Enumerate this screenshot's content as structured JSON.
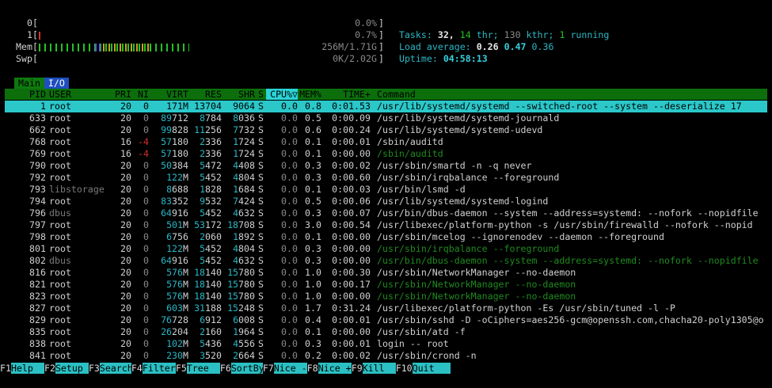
{
  "meters": {
    "cpu0": {
      "label": "0",
      "bracket_open": "[",
      "bracket_close": "]",
      "value": "0.0%",
      "fill": 0.0
    },
    "cpu1": {
      "label": "1",
      "bracket_open": "[",
      "bracket_close": "]",
      "value": "0.7%",
      "fill": 0.007
    },
    "mem": {
      "label": "Mem",
      "bracket_open": "[",
      "bracket_close": "]",
      "value": "256M/1.71G",
      "fill": 0.146
    },
    "swp": {
      "label": "Swp",
      "bracket_open": "[",
      "bracket_close": "]",
      "value": "0K/2.02G",
      "fill": 0.0
    }
  },
  "summary": {
    "tasks_label": "Tasks:",
    "tasks": "32,",
    "threads": "14",
    "thr_label": "thr;",
    "kthreads": "130",
    "kthr_label": "kthr;",
    "running": "1",
    "running_label": "running",
    "load_label": "Load average:",
    "load1": "0.26",
    "load5": "0.47",
    "load15": "0.36",
    "uptime_label": "Uptime:",
    "uptime": "04:58:13"
  },
  "tabs": [
    {
      "label": "Main"
    },
    {
      "label": "I/O"
    }
  ],
  "columns": [
    "PID",
    "USER",
    "PRI",
    "NI",
    "VIRT",
    "RES",
    "SHR",
    "S",
    "CPU%▽",
    "MEM%",
    "TIME+",
    "Command"
  ],
  "processes": [
    {
      "pid": "1",
      "user": "root",
      "pri": "20",
      "ni": "0",
      "virt": "171M",
      "res": "13704",
      "shr": "9064",
      "s": "S",
      "cpu": "0.0",
      "mem": "0.8",
      "time": "0:01.53",
      "cmd": "/usr/lib/systemd/systemd --switched-root --system --deserialize 17",
      "selected": true
    },
    {
      "pid": "633",
      "user": "root",
      "pri": "20",
      "ni": "0",
      "virt": "89712",
      "res": "8784",
      "shr": "8036",
      "s": "S",
      "cpu": "0.0",
      "mem": "0.5",
      "time": "0:00.09",
      "cmd": "/usr/lib/systemd/systemd-journald"
    },
    {
      "pid": "662",
      "user": "root",
      "pri": "20",
      "ni": "0",
      "virt": "99828",
      "res": "11256",
      "shr": "7732",
      "s": "S",
      "cpu": "0.0",
      "mem": "0.6",
      "time": "0:00.24",
      "cmd": "/usr/lib/systemd/systemd-udevd"
    },
    {
      "pid": "768",
      "user": "root",
      "pri": "16",
      "ni": "-4",
      "virt": "57180",
      "res": "2336",
      "shr": "1724",
      "s": "S",
      "cpu": "0.0",
      "mem": "0.1",
      "time": "0:00.01",
      "cmd": "/sbin/auditd"
    },
    {
      "pid": "769",
      "user": "root",
      "pri": "16",
      "ni": "-4",
      "virt": "57180",
      "res": "2336",
      "shr": "1724",
      "s": "S",
      "cpu": "0.0",
      "mem": "0.1",
      "time": "0:00.00",
      "cmd": "/sbin/auditd",
      "thread": true
    },
    {
      "pid": "790",
      "user": "root",
      "pri": "20",
      "ni": "0",
      "virt": "50384",
      "res": "5472",
      "shr": "4408",
      "s": "S",
      "cpu": "0.0",
      "mem": "0.3",
      "time": "0:00.02",
      "cmd": "/usr/sbin/smartd -n -q never"
    },
    {
      "pid": "792",
      "user": "root",
      "pri": "20",
      "ni": "0",
      "virt": "122M",
      "res": "5452",
      "shr": "4804",
      "s": "S",
      "cpu": "0.0",
      "mem": "0.3",
      "time": "0:00.60",
      "cmd": "/usr/sbin/irqbalance --foreground"
    },
    {
      "pid": "793",
      "user": "libstorage",
      "pri": "20",
      "ni": "0",
      "virt": "8688",
      "res": "1828",
      "shr": "1684",
      "s": "S",
      "cpu": "0.0",
      "mem": "0.1",
      "time": "0:00.03",
      "cmd": "/usr/bin/lsmd -d",
      "dimuser": true
    },
    {
      "pid": "794",
      "user": "root",
      "pri": "20",
      "ni": "0",
      "virt": "83352",
      "res": "9532",
      "shr": "7424",
      "s": "S",
      "cpu": "0.0",
      "mem": "0.5",
      "time": "0:00.06",
      "cmd": "/usr/lib/systemd/systemd-logind"
    },
    {
      "pid": "796",
      "user": "dbus",
      "pri": "20",
      "ni": "0",
      "virt": "64916",
      "res": "5452",
      "shr": "4632",
      "s": "S",
      "cpu": "0.0",
      "mem": "0.3",
      "time": "0:00.07",
      "cmd": "/usr/bin/dbus-daemon --system --address=systemd: --nofork --nopidfile",
      "dimuser": true
    },
    {
      "pid": "797",
      "user": "root",
      "pri": "20",
      "ni": "0",
      "virt": "501M",
      "res": "53172",
      "shr": "18708",
      "s": "S",
      "cpu": "0.0",
      "mem": "3.0",
      "time": "0:00.54",
      "cmd": "/usr/libexec/platform-python -s /usr/sbin/firewalld --nofork --nopid"
    },
    {
      "pid": "798",
      "user": "root",
      "pri": "20",
      "ni": "0",
      "virt": "6756",
      "res": "2060",
      "shr": "1892",
      "s": "S",
      "cpu": "0.0",
      "mem": "0.1",
      "time": "0:00.00",
      "cmd": "/usr/sbin/mcelog --ignorenodev --daemon --foreground"
    },
    {
      "pid": "801",
      "user": "root",
      "pri": "20",
      "ni": "0",
      "virt": "122M",
      "res": "5452",
      "shr": "4804",
      "s": "S",
      "cpu": "0.0",
      "mem": "0.3",
      "time": "0:00.00",
      "cmd": "/usr/sbin/irqbalance --foreground",
      "thread": true
    },
    {
      "pid": "802",
      "user": "dbus",
      "pri": "20",
      "ni": "0",
      "virt": "64916",
      "res": "5452",
      "shr": "4632",
      "s": "S",
      "cpu": "0.0",
      "mem": "0.3",
      "time": "0:00.00",
      "cmd": "/usr/bin/dbus-daemon --system --address=systemd: --nofork --nopidfile",
      "thread": true,
      "dimuser": true
    },
    {
      "pid": "816",
      "user": "root",
      "pri": "20",
      "ni": "0",
      "virt": "576M",
      "res": "18140",
      "shr": "15780",
      "s": "S",
      "cpu": "0.0",
      "mem": "1.0",
      "time": "0:00.30",
      "cmd": "/usr/sbin/NetworkManager --no-daemon"
    },
    {
      "pid": "821",
      "user": "root",
      "pri": "20",
      "ni": "0",
      "virt": "576M",
      "res": "18140",
      "shr": "15780",
      "s": "S",
      "cpu": "0.0",
      "mem": "1.0",
      "time": "0:00.17",
      "cmd": "/usr/sbin/NetworkManager --no-daemon",
      "thread": true
    },
    {
      "pid": "823",
      "user": "root",
      "pri": "20",
      "ni": "0",
      "virt": "576M",
      "res": "18140",
      "shr": "15780",
      "s": "S",
      "cpu": "0.0",
      "mem": "1.0",
      "time": "0:00.00",
      "cmd": "/usr/sbin/NetworkManager --no-daemon",
      "thread": true
    },
    {
      "pid": "827",
      "user": "root",
      "pri": "20",
      "ni": "0",
      "virt": "603M",
      "res": "31188",
      "shr": "15248",
      "s": "S",
      "cpu": "0.0",
      "mem": "1.7",
      "time": "0:31.24",
      "cmd": "/usr/libexec/platform-python -Es /usr/sbin/tuned -l -P"
    },
    {
      "pid": "829",
      "user": "root",
      "pri": "20",
      "ni": "0",
      "virt": "76728",
      "res": "6912",
      "shr": "6008",
      "s": "S",
      "cpu": "0.0",
      "mem": "0.4",
      "time": "0:00.01",
      "cmd": "/usr/sbin/sshd -D -oCiphers=aes256-gcm@openssh.com,chacha20-poly1305@o"
    },
    {
      "pid": "835",
      "user": "root",
      "pri": "20",
      "ni": "0",
      "virt": "26204",
      "res": "2160",
      "shr": "1964",
      "s": "S",
      "cpu": "0.0",
      "mem": "0.1",
      "time": "0:00.00",
      "cmd": "/usr/sbin/atd -f"
    },
    {
      "pid": "838",
      "user": "root",
      "pri": "20",
      "ni": "0",
      "virt": "102M",
      "res": "5436",
      "shr": "4556",
      "s": "S",
      "cpu": "0.0",
      "mem": "0.3",
      "time": "0:00.01",
      "cmd": "login -- root"
    },
    {
      "pid": "841",
      "user": "root",
      "pri": "20",
      "ni": "0",
      "virt": "230M",
      "res": "3520",
      "shr": "2664",
      "s": "S",
      "cpu": "0.0",
      "mem": "0.2",
      "time": "0:00.02",
      "cmd": "/usr/sbin/crond -n"
    }
  ],
  "footer": [
    {
      "key": "F1",
      "label": "Help"
    },
    {
      "key": "F2",
      "label": "Setup"
    },
    {
      "key": "F3",
      "label": "Search"
    },
    {
      "key": "F4",
      "label": "Filter"
    },
    {
      "key": "F5",
      "label": "Tree"
    },
    {
      "key": "F6",
      "label": "SortBy"
    },
    {
      "key": "F7",
      "label": "Nice -"
    },
    {
      "key": "F8",
      "label": "Nice +"
    },
    {
      "key": "F9",
      "label": "Kill"
    },
    {
      "key": "F10",
      "label": "Quit"
    }
  ],
  "colors": {
    "header_bg": "#0c6f0c",
    "selection": "#2bc7c9",
    "accent_cyan": "#2ab7c4",
    "green": "#22c322",
    "red": "#d23030"
  }
}
